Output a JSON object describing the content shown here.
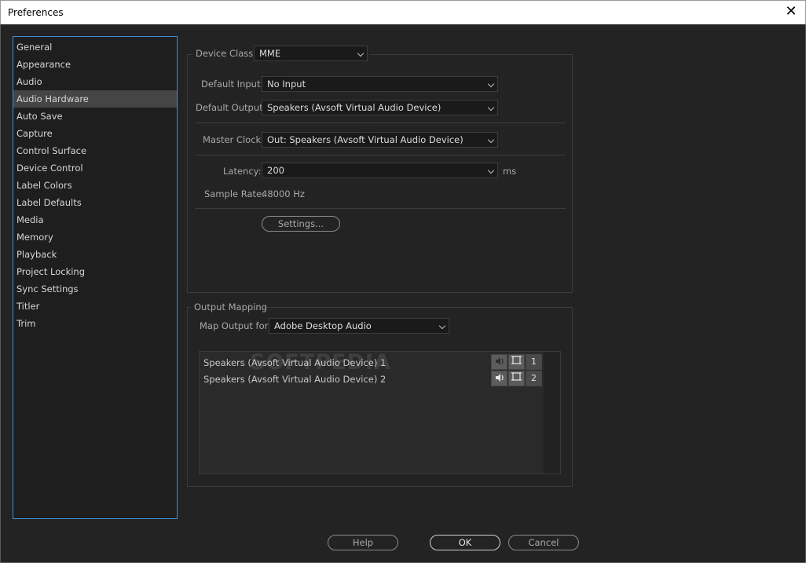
{
  "window": {
    "title": "Preferences",
    "close_glyph": "✕"
  },
  "sidebar": {
    "items": [
      {
        "label": "General"
      },
      {
        "label": "Appearance"
      },
      {
        "label": "Audio"
      },
      {
        "label": "Audio Hardware",
        "selected": true
      },
      {
        "label": "Auto Save"
      },
      {
        "label": "Capture"
      },
      {
        "label": "Control Surface"
      },
      {
        "label": "Device Control"
      },
      {
        "label": "Label Colors"
      },
      {
        "label": "Label Defaults"
      },
      {
        "label": "Media"
      },
      {
        "label": "Memory"
      },
      {
        "label": "Playback"
      },
      {
        "label": "Project Locking"
      },
      {
        "label": "Sync Settings"
      },
      {
        "label": "Titler"
      },
      {
        "label": "Trim"
      }
    ]
  },
  "audio_hardware": {
    "device_class": {
      "label": "Device Class:",
      "value": "MME"
    },
    "default_input": {
      "label": "Default Input:",
      "value": "No Input"
    },
    "default_output": {
      "label": "Default Output:",
      "value": "Speakers (Avsoft Virtual Audio Device)"
    },
    "master_clock": {
      "label": "Master Clock:",
      "value": "Out: Speakers (Avsoft Virtual Audio Device)"
    },
    "latency": {
      "label": "Latency:",
      "value": "200",
      "unit": "ms"
    },
    "sample_rate": {
      "label": "Sample Rate:",
      "value": "48000 Hz"
    },
    "settings_button": "Settings..."
  },
  "output_mapping": {
    "title": "Output Mapping",
    "map_output_for": {
      "label": "Map Output for:",
      "value": "Adobe Desktop Audio"
    },
    "rows": [
      {
        "label": "Speakers (Avsoft Virtual Audio Device) 1",
        "channel": "1"
      },
      {
        "label": "Speakers (Avsoft Virtual Audio Device) 2",
        "channel": "2"
      }
    ],
    "watermark": "SOFTPEDIA"
  },
  "footer": {
    "help": "Help",
    "ok": "OK",
    "cancel": "Cancel"
  },
  "colors": {
    "selection_border": "#3d8fd8",
    "background": "#232323",
    "selected_item": "#454545"
  }
}
